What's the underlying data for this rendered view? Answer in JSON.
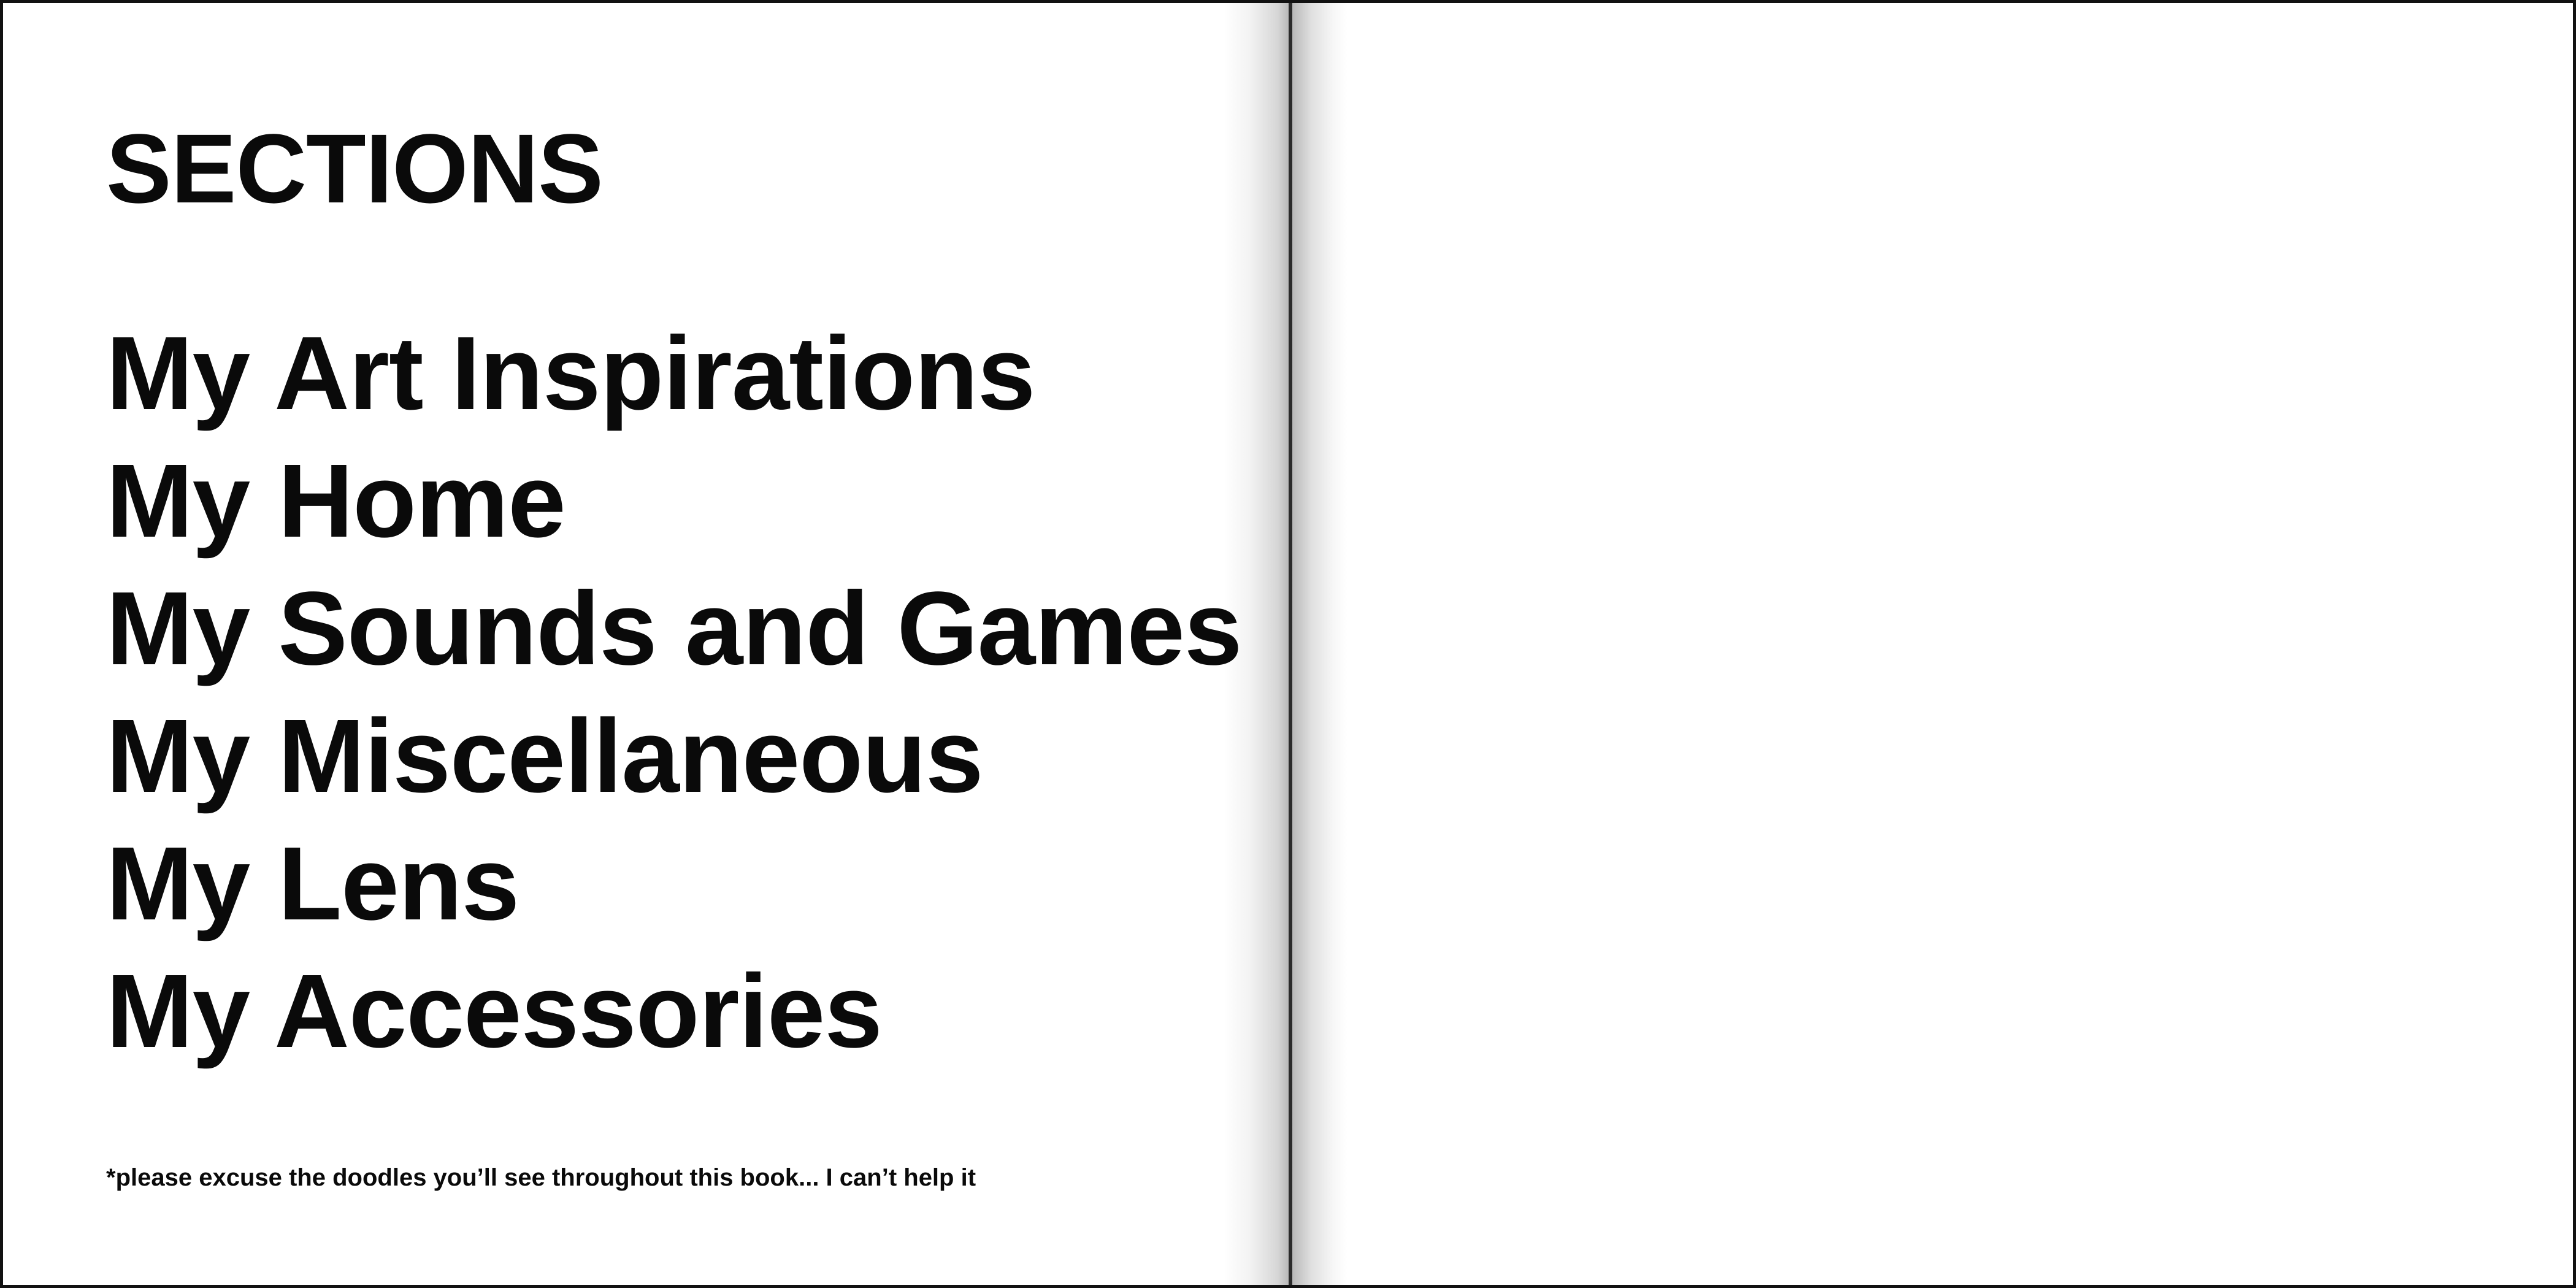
{
  "book": {
    "left_page": {
      "heading": "SECTIONS",
      "sections": [
        {
          "label": "My Art Inspirations"
        },
        {
          "label": "My Home"
        },
        {
          "label": "My Sounds and Games"
        },
        {
          "label": "My Miscellaneous"
        },
        {
          "label": "My Lens"
        },
        {
          "label": "My Accessories"
        }
      ],
      "footnote": "*please excuse the doodles you’ll see throughout this book... I can’t help it"
    },
    "right_page": {}
  },
  "colors": {
    "text": "#0a0a0a",
    "page": "#ffffff",
    "border": "#111111"
  }
}
